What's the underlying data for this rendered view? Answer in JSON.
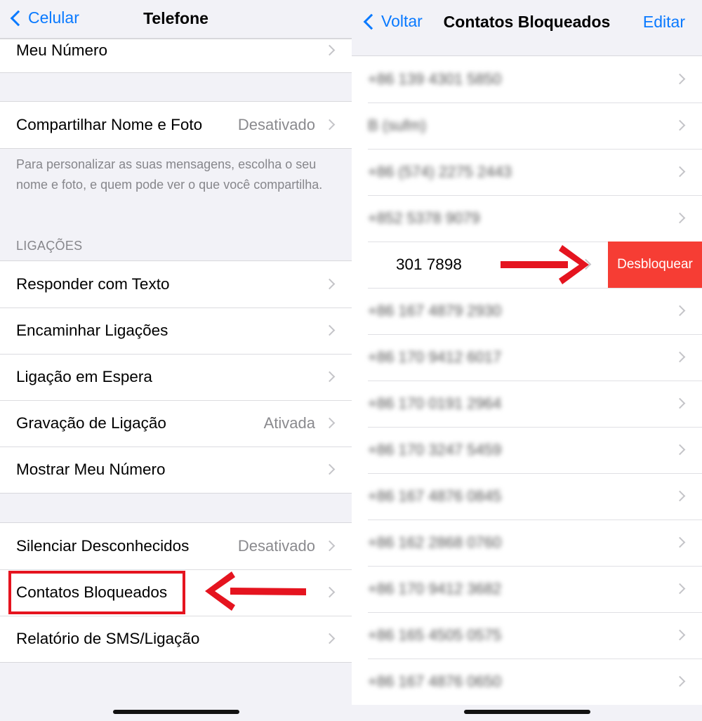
{
  "left": {
    "back_label": "Celular",
    "title": "Telefone",
    "my_number": "Meu Número",
    "share_name_photo": {
      "label": "Compartilhar Nome e Foto",
      "value": "Desativado"
    },
    "share_footnote": "Para personalizar as suas mensagens, escolha o seu nome e foto, e quem pode ver o que você compartilha.",
    "calls_header": "LIGAÇÕES",
    "calls_items": [
      {
        "label": "Responder com Texto",
        "value": ""
      },
      {
        "label": "Encaminhar Ligações",
        "value": ""
      },
      {
        "label": "Ligação em Espera",
        "value": ""
      },
      {
        "label": "Gravação de Ligação",
        "value": "Ativada"
      },
      {
        "label": "Mostrar Meu Número",
        "value": ""
      }
    ],
    "silence_unknown": {
      "label": "Silenciar Desconhecidos",
      "value": "Desativado"
    },
    "blocked_contacts": "Contatos Bloqueados",
    "sms_report": "Relatório de SMS/Ligação"
  },
  "right": {
    "back_label": "Voltar",
    "title": "Contatos Bloqueados",
    "edit_label": "Editar",
    "contacts": [
      "+86 139 4301 5850",
      "B (sufm)",
      "+86 (574) 2275 2443",
      "+852 5378 9079",
      "301 7898",
      "+86 167 4879 2930",
      "+86 170 9412 6017",
      "+86 170 0191 2964",
      "+86 170 3247 5459",
      "+86 167 4876 0845",
      "+86 162 2868 0760",
      "+86 170 9412 3682",
      "+86 165 4505 0575",
      "+86 167 4876 0650"
    ],
    "swiped_index": 4,
    "unblock_label": "Desbloquear"
  },
  "colors": {
    "ios_blue": "#0a7aff",
    "destructive_red": "#f63d34",
    "annotation_red": "#e5141f",
    "grouped_background": "#f2f2f7"
  }
}
